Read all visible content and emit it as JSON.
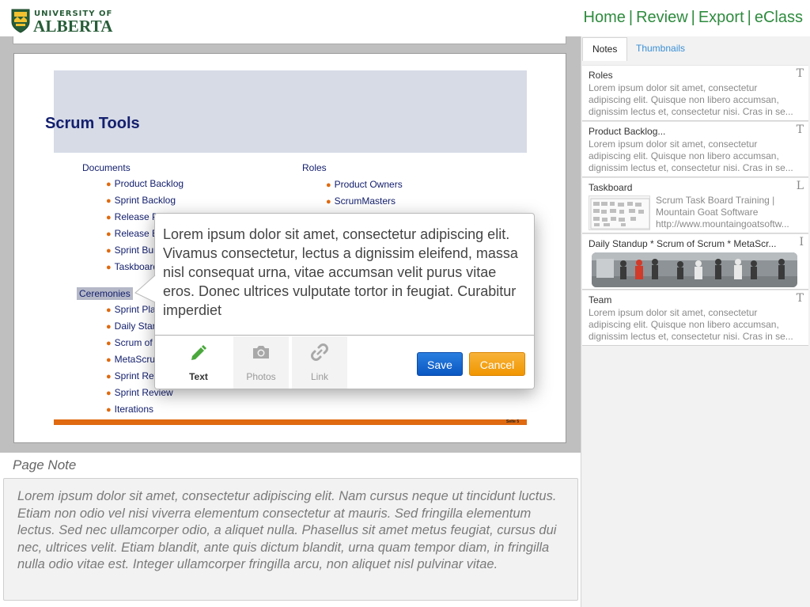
{
  "header": {
    "logo": {
      "top": "UNIVERSITY OF",
      "main": "ALBERTA"
    },
    "nav": [
      "Home",
      "Review",
      "Export",
      "eClass"
    ],
    "nav_separator": "|",
    "nav_color": "#2e8b3e"
  },
  "slide": {
    "title": "Scrum Tools",
    "col1_heading": "Documents",
    "col1_items": [
      "Product Backlog",
      "Sprint Backlog",
      "Release P",
      "Release B",
      "Sprint Bur",
      "Taskboard"
    ],
    "col2_heading": "Roles",
    "col2_items": [
      "Product Owners",
      "ScrumMasters"
    ],
    "ceremonies_label": "Ceremonies",
    "ceremonies_items": [
      "Sprint Pla",
      "Daily Stan",
      "Scrum of S",
      "MetaScrum",
      "Sprint Ret",
      "Sprint Review",
      "Iterations"
    ],
    "footer": "Seite 5",
    "accent_color": "#e06a10"
  },
  "popup": {
    "text": "Lorem ipsum dolor sit amet, consectetur adipiscing elit. Vivamus consectetur, lectus a dignissim eleifend, massa nisl consequat urna, vitae accumsan velit purus vitae eros. Donec ultrices vulputate tortor in feugiat. Curabitur imperdiet",
    "tools": [
      {
        "label": "Text",
        "icon": "pencil-icon",
        "active": true
      },
      {
        "label": "Photos",
        "icon": "camera-icon",
        "active": false
      },
      {
        "label": "Link",
        "icon": "chain-link-icon",
        "active": false
      }
    ],
    "save_label": "Save",
    "cancel_label": "Cancel"
  },
  "page_note": {
    "label": "Page Note",
    "text": "Lorem ipsum dolor sit amet, consectetur adipiscing elit. Nam cursus neque ut tincidunt luctus. Etiam non odio vel nisi viverra elementum consectetur at mauris. Sed fringilla elementum lectus. Sed nec ullamcorper odio, a aliquet nulla. Phasellus sit amet metus feugiat, cursus dui nec, ultrices velit. Etiam blandit, ante quis dictum blandit, urna quam tempor diam, in fringilla nulla odio vitae est. Integer ullamcorper fringilla arcu, non aliquet nisl pulvinar vitae."
  },
  "sidebar": {
    "tabs": [
      "Notes",
      "Thumbnails"
    ],
    "notes": [
      {
        "title": "Roles",
        "type": "T",
        "body": "Lorem ipsum dolor sit amet, consectetur adipiscing elit. Quisque non libero accumsan, dignissim lectus et, consectetur nisi. Cras in se..."
      },
      {
        "title": "Product Backlog...",
        "type": "T",
        "body": "Lorem ipsum dolor sit amet, consectetur adipiscing elit. Quisque non libero accumsan, dignissim lectus et, consectetur nisi. Cras in se..."
      },
      {
        "title": "Taskboard",
        "type": "L",
        "link_title": "Scrum Task Board Training | Mountain Goat Software",
        "link_url": "http://www.mountaingoatsoftw..."
      },
      {
        "title": "Daily Standup * Scrum of Scrum * MetaScr...",
        "type": "I"
      },
      {
        "title": "Team",
        "type": "T",
        "body": "Lorem ipsum dolor sit amet, consectetur adipiscing elit. Quisque non libero accumsan, dignissim lectus et, consectetur nisi. Cras in se..."
      }
    ]
  }
}
